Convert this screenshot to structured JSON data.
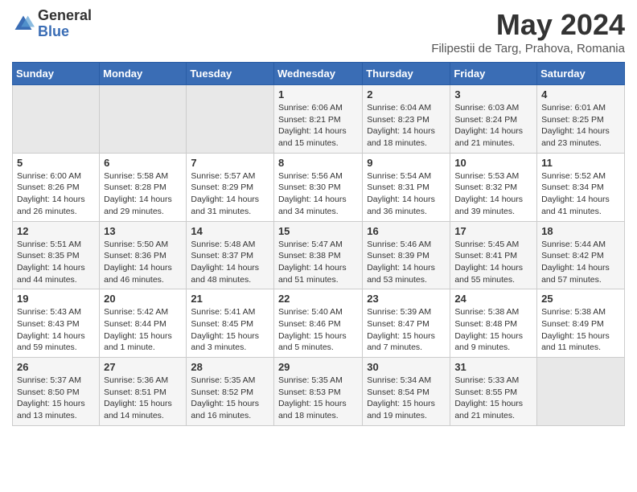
{
  "logo": {
    "general": "General",
    "blue": "Blue"
  },
  "title": "May 2024",
  "location": "Filipestii de Targ, Prahova, Romania",
  "days_of_week": [
    "Sunday",
    "Monday",
    "Tuesday",
    "Wednesday",
    "Thursday",
    "Friday",
    "Saturday"
  ],
  "weeks": [
    [
      {
        "day": "",
        "info": ""
      },
      {
        "day": "",
        "info": ""
      },
      {
        "day": "",
        "info": ""
      },
      {
        "day": "1",
        "info": "Sunrise: 6:06 AM\nSunset: 8:21 PM\nDaylight: 14 hours\nand 15 minutes."
      },
      {
        "day": "2",
        "info": "Sunrise: 6:04 AM\nSunset: 8:23 PM\nDaylight: 14 hours\nand 18 minutes."
      },
      {
        "day": "3",
        "info": "Sunrise: 6:03 AM\nSunset: 8:24 PM\nDaylight: 14 hours\nand 21 minutes."
      },
      {
        "day": "4",
        "info": "Sunrise: 6:01 AM\nSunset: 8:25 PM\nDaylight: 14 hours\nand 23 minutes."
      }
    ],
    [
      {
        "day": "5",
        "info": "Sunrise: 6:00 AM\nSunset: 8:26 PM\nDaylight: 14 hours\nand 26 minutes."
      },
      {
        "day": "6",
        "info": "Sunrise: 5:58 AM\nSunset: 8:28 PM\nDaylight: 14 hours\nand 29 minutes."
      },
      {
        "day": "7",
        "info": "Sunrise: 5:57 AM\nSunset: 8:29 PM\nDaylight: 14 hours\nand 31 minutes."
      },
      {
        "day": "8",
        "info": "Sunrise: 5:56 AM\nSunset: 8:30 PM\nDaylight: 14 hours\nand 34 minutes."
      },
      {
        "day": "9",
        "info": "Sunrise: 5:54 AM\nSunset: 8:31 PM\nDaylight: 14 hours\nand 36 minutes."
      },
      {
        "day": "10",
        "info": "Sunrise: 5:53 AM\nSunset: 8:32 PM\nDaylight: 14 hours\nand 39 minutes."
      },
      {
        "day": "11",
        "info": "Sunrise: 5:52 AM\nSunset: 8:34 PM\nDaylight: 14 hours\nand 41 minutes."
      }
    ],
    [
      {
        "day": "12",
        "info": "Sunrise: 5:51 AM\nSunset: 8:35 PM\nDaylight: 14 hours\nand 44 minutes."
      },
      {
        "day": "13",
        "info": "Sunrise: 5:50 AM\nSunset: 8:36 PM\nDaylight: 14 hours\nand 46 minutes."
      },
      {
        "day": "14",
        "info": "Sunrise: 5:48 AM\nSunset: 8:37 PM\nDaylight: 14 hours\nand 48 minutes."
      },
      {
        "day": "15",
        "info": "Sunrise: 5:47 AM\nSunset: 8:38 PM\nDaylight: 14 hours\nand 51 minutes."
      },
      {
        "day": "16",
        "info": "Sunrise: 5:46 AM\nSunset: 8:39 PM\nDaylight: 14 hours\nand 53 minutes."
      },
      {
        "day": "17",
        "info": "Sunrise: 5:45 AM\nSunset: 8:41 PM\nDaylight: 14 hours\nand 55 minutes."
      },
      {
        "day": "18",
        "info": "Sunrise: 5:44 AM\nSunset: 8:42 PM\nDaylight: 14 hours\nand 57 minutes."
      }
    ],
    [
      {
        "day": "19",
        "info": "Sunrise: 5:43 AM\nSunset: 8:43 PM\nDaylight: 14 hours\nand 59 minutes."
      },
      {
        "day": "20",
        "info": "Sunrise: 5:42 AM\nSunset: 8:44 PM\nDaylight: 15 hours\nand 1 minute."
      },
      {
        "day": "21",
        "info": "Sunrise: 5:41 AM\nSunset: 8:45 PM\nDaylight: 15 hours\nand 3 minutes."
      },
      {
        "day": "22",
        "info": "Sunrise: 5:40 AM\nSunset: 8:46 PM\nDaylight: 15 hours\nand 5 minutes."
      },
      {
        "day": "23",
        "info": "Sunrise: 5:39 AM\nSunset: 8:47 PM\nDaylight: 15 hours\nand 7 minutes."
      },
      {
        "day": "24",
        "info": "Sunrise: 5:38 AM\nSunset: 8:48 PM\nDaylight: 15 hours\nand 9 minutes."
      },
      {
        "day": "25",
        "info": "Sunrise: 5:38 AM\nSunset: 8:49 PM\nDaylight: 15 hours\nand 11 minutes."
      }
    ],
    [
      {
        "day": "26",
        "info": "Sunrise: 5:37 AM\nSunset: 8:50 PM\nDaylight: 15 hours\nand 13 minutes."
      },
      {
        "day": "27",
        "info": "Sunrise: 5:36 AM\nSunset: 8:51 PM\nDaylight: 15 hours\nand 14 minutes."
      },
      {
        "day": "28",
        "info": "Sunrise: 5:35 AM\nSunset: 8:52 PM\nDaylight: 15 hours\nand 16 minutes."
      },
      {
        "day": "29",
        "info": "Sunrise: 5:35 AM\nSunset: 8:53 PM\nDaylight: 15 hours\nand 18 minutes."
      },
      {
        "day": "30",
        "info": "Sunrise: 5:34 AM\nSunset: 8:54 PM\nDaylight: 15 hours\nand 19 minutes."
      },
      {
        "day": "31",
        "info": "Sunrise: 5:33 AM\nSunset: 8:55 PM\nDaylight: 15 hours\nand 21 minutes."
      },
      {
        "day": "",
        "info": ""
      }
    ]
  ]
}
